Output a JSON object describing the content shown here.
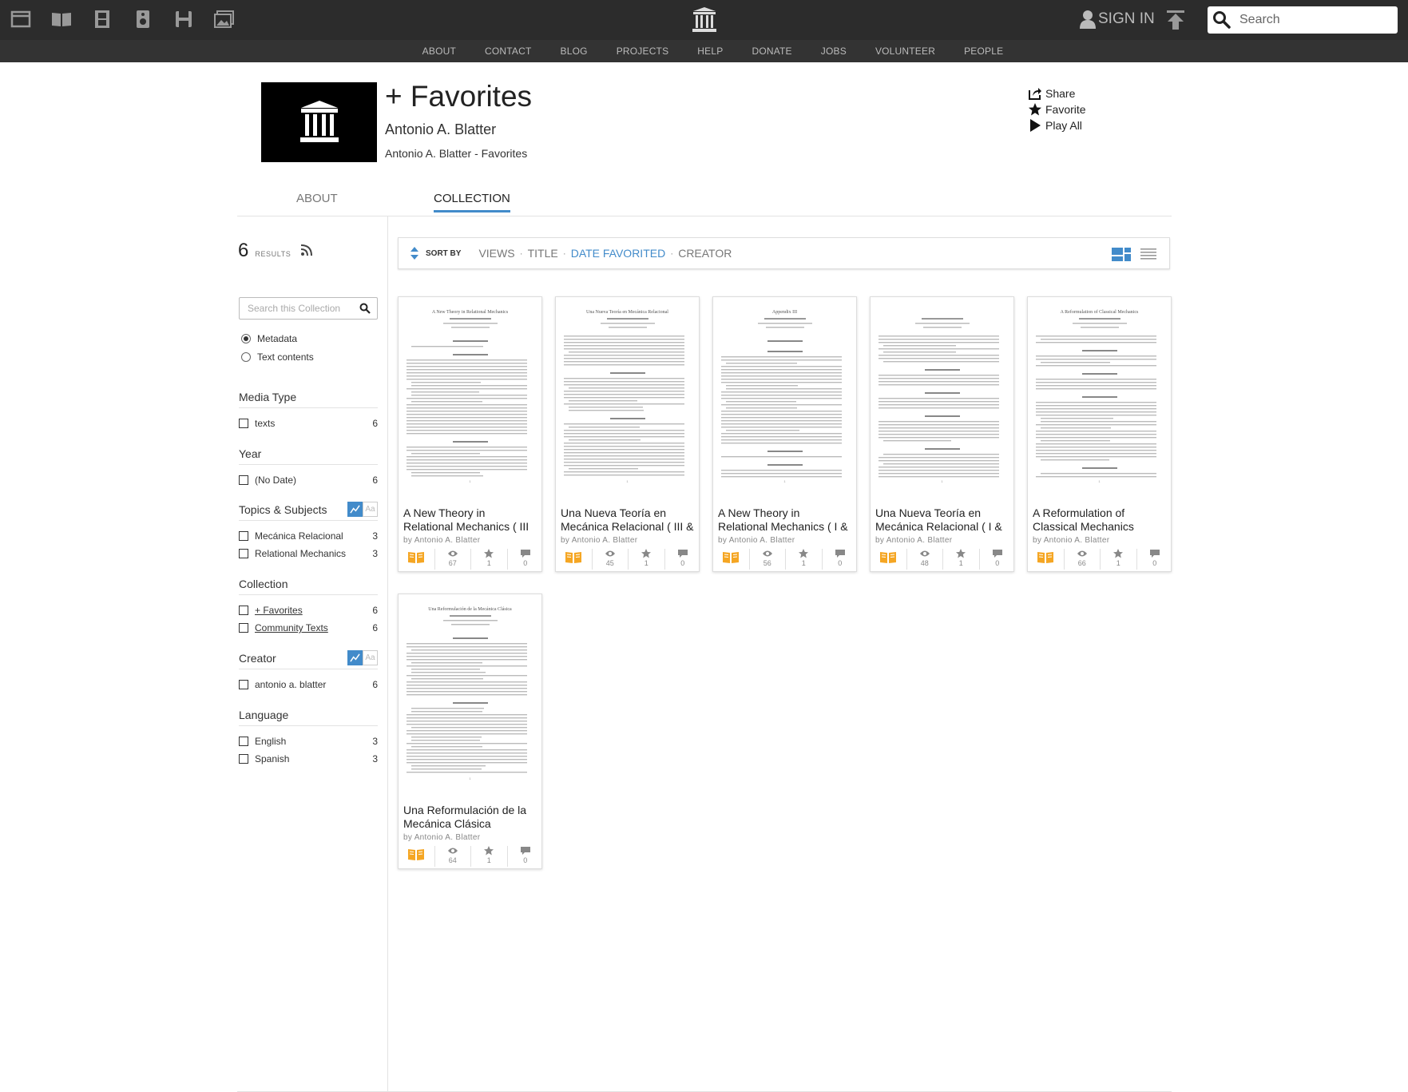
{
  "topbar": {
    "media_icons": [
      "web-icon",
      "texts-icon",
      "video-icon",
      "audio-icon",
      "software-icon",
      "images-icon"
    ],
    "logo": "archive-logo-icon",
    "signin_label": "SIGN IN",
    "search_placeholder": "Search"
  },
  "nav": [
    "ABOUT",
    "CONTACT",
    "BLOG",
    "PROJECTS",
    "HELP",
    "DONATE",
    "JOBS",
    "VOLUNTEER",
    "PEOPLE"
  ],
  "collection": {
    "title": "+ Favorites",
    "author": "Antonio A. Blatter",
    "subtitle": "Antonio A. Blatter - Favorites"
  },
  "actions": {
    "share": "Share",
    "favorite": "Favorite",
    "play_all": "Play All"
  },
  "tabs": {
    "about": "ABOUT",
    "collection": "COLLECTION"
  },
  "sidebar": {
    "results_count": "6",
    "results_label": "RESULTS",
    "search_placeholder": "Search this Collection",
    "radio_metadata": "Metadata",
    "radio_text": "Text contents",
    "facets": [
      {
        "title": "Media Type",
        "rows": [
          {
            "label": "texts",
            "count": "6"
          }
        ]
      },
      {
        "title": "Year",
        "rows": [
          {
            "label": "(No Date)",
            "count": "6"
          }
        ]
      },
      {
        "title": "Topics & Subjects",
        "rows": [
          {
            "label": "Mecánica Relacional",
            "count": "3"
          },
          {
            "label": "Relational Mechanics",
            "count": "3"
          }
        ]
      },
      {
        "title": "Collection",
        "rows": [
          {
            "label": "+ Favorites",
            "count": "6"
          },
          {
            "label": "Community Texts",
            "count": "6"
          }
        ]
      },
      {
        "title": "Creator",
        "rows": [
          {
            "label": "antonio a. blatter",
            "count": "6"
          }
        ]
      },
      {
        "title": "Language",
        "rows": [
          {
            "label": "English",
            "count": "3"
          },
          {
            "label": "Spanish",
            "count": "3"
          }
        ]
      }
    ]
  },
  "sort": {
    "label": "SORT BY",
    "options": [
      "VIEWS",
      "TITLE",
      "DATE FAVORITED",
      "CREATOR"
    ],
    "active": "DATE FAVORITED"
  },
  "items": [
    {
      "title": "A New Theory in Relational Mechanics ( III",
      "by": "by Antonio A. Blatter",
      "views": "67",
      "favs": "1",
      "reviews": "0",
      "doc_heading": "A New Theory in Relational Mechanics"
    },
    {
      "title": "Una Nueva Teoría en Mecánica Relacional ( III &",
      "by": "by Antonio A. Blatter",
      "views": "45",
      "favs": "1",
      "reviews": "0",
      "doc_heading": "Una Nueva Teoría en Mecánica Relacional"
    },
    {
      "title": "A New Theory in Relational Mechanics ( I &",
      "by": "by Antonio A. Blatter",
      "views": "56",
      "favs": "1",
      "reviews": "0",
      "doc_heading": "Appendix III"
    },
    {
      "title": "Una Nueva Teoría en Mecánica Relacional ( I &",
      "by": "by Antonio A. Blatter",
      "views": "48",
      "favs": "1",
      "reviews": "0",
      "doc_heading": ""
    },
    {
      "title": "A Reformulation of Classical Mechanics",
      "by": "by Antonio A. Blatter",
      "views": "66",
      "favs": "1",
      "reviews": "0",
      "doc_heading": "A Reformulation of Classical Mechanics"
    },
    {
      "title": "Una Reformulación de la Mecánica Clásica",
      "by": "by Antonio A. Blatter",
      "views": "64",
      "favs": "1",
      "reviews": "0",
      "doc_heading": "Una Reformulación de la Mecánica Clásica"
    }
  ]
}
